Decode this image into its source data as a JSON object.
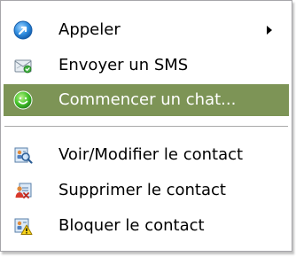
{
  "menu": {
    "items": [
      {
        "label": "Appeler",
        "icon": "call-icon",
        "submenu": true
      },
      {
        "label": "Envoyer un SMS",
        "icon": "sms-envelope-icon"
      },
      {
        "label": "Commencer un chat...",
        "icon": "chat-smiley-icon",
        "selected": true
      },
      {
        "label": "Voir/Modifier le contact",
        "icon": "view-edit-contact-icon"
      },
      {
        "label": "Supprimer le contact",
        "icon": "delete-contact-icon"
      },
      {
        "label": "Bloquer le contact",
        "icon": "block-contact-icon"
      }
    ]
  },
  "colors": {
    "highlight": "#7d9456",
    "highlight_text": "#ffffff",
    "text": "#000000",
    "border": "#a7a6aa"
  }
}
